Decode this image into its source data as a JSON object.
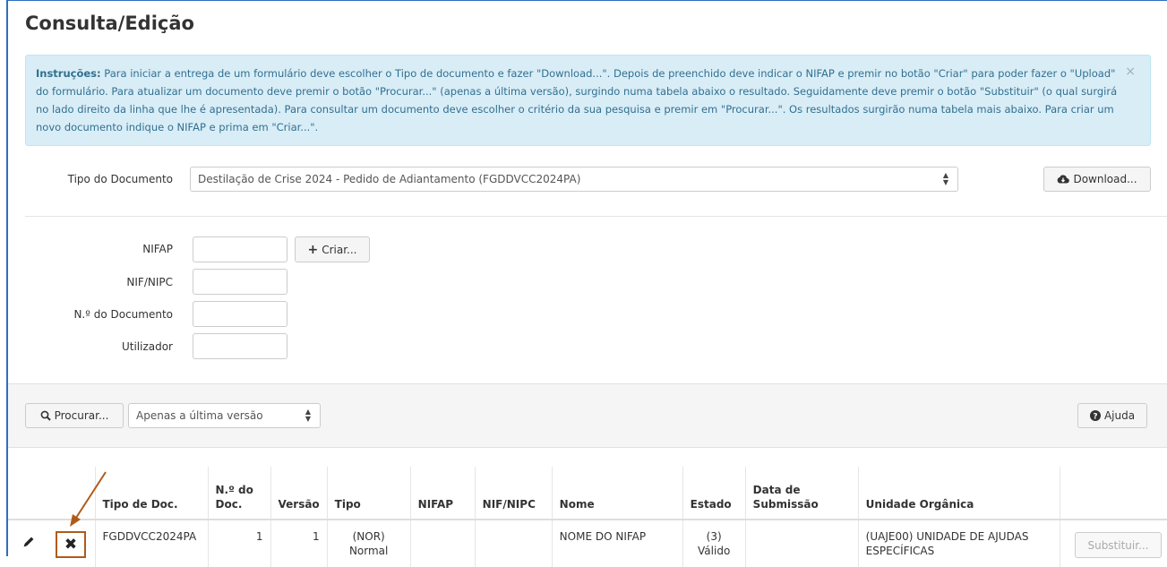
{
  "page": {
    "title": "Consulta/Edição"
  },
  "alert": {
    "label": "Instruções:",
    "text": " Para iniciar a entrega de um formulário deve escolher o Tipo de documento e fazer \"Download...\". Depois de preenchido deve indicar o NIFAP e premir no botão \"Criar\" para poder fazer o \"Upload\" do formulário. Para atualizar um documento deve premir o botão \"Procurar...\" (apenas a última versão), surgindo numa tabela abaixo o resultado. Seguidamente deve premir o botão \"Substituir\" (o qual surgirá no lado direito da linha que lhe é apresentada). Para consultar um documento deve escolher o critério da sua pesquisa e premir em \"Procurar...\". Os resultados surgirão numa tabela mais abaixo. Para criar um novo documento indique o NIFAP e prima em \"Criar...\".",
    "close": "×"
  },
  "doc_type": {
    "label": "Tipo do Documento",
    "selected": "Destilação de Crise 2024 - Pedido de Adiantamento (FGDDVCC2024PA)",
    "download_label": "Download..."
  },
  "form": {
    "nifap_label": "NIFAP",
    "nifap_value": "",
    "create_label": "Criar...",
    "nif_label": "NIF/NIPC",
    "nif_value": "",
    "docnum_label": "N.º do Documento",
    "docnum_value": "",
    "user_label": "Utilizador",
    "user_value": ""
  },
  "toolbar": {
    "search_label": "Procurar...",
    "version_selected": "Apenas a última versão",
    "help_label": "Ajuda"
  },
  "table": {
    "headers": {
      "doc_type": "Tipo de Doc.",
      "doc_num": "N.º do Doc.",
      "version": "Versão",
      "type": "Tipo",
      "nifap": "NIFAP",
      "nif": "NIF/NIPC",
      "name": "Nome",
      "state": "Estado",
      "submit_date": "Data de Submissão",
      "unit": "Unidade Orgânica"
    },
    "rows": [
      {
        "doc_type": "FGDDVCC2024PA",
        "doc_num": "1",
        "version": "1",
        "type": "(NOR) Normal",
        "nifap": "",
        "nif": "",
        "name": "NOME DO NIFAP",
        "state": "(3) Válido",
        "submit_date": "",
        "unit": "(UAJE00) UNIDADE DE AJUDAS ESPECÍFICAS",
        "replace_label": "Substituir..."
      }
    ]
  },
  "colors": {
    "alert_bg": "#d9edf7",
    "alert_text": "#31708f",
    "highlight": "#b05a1a"
  }
}
